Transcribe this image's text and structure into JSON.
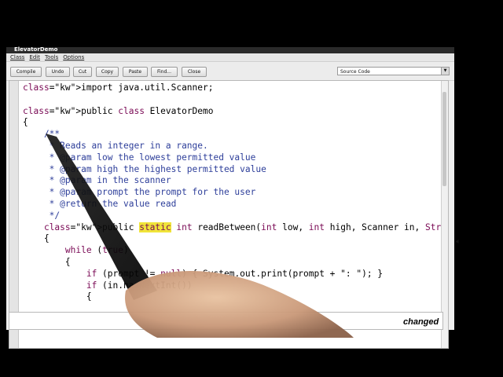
{
  "window": {
    "title": "ElevatorDemo"
  },
  "menu": [
    "Class",
    "Edit",
    "Tools",
    "Options"
  ],
  "toolbar": {
    "buttons": [
      "Compile",
      "Undo",
      "Cut",
      "Copy",
      "Paste",
      "Find...",
      "Close"
    ],
    "view_select": "Source Code"
  },
  "editor": {
    "lines": [
      "import java.util.Scanner;",
      "",
      "public class ElevatorDemo",
      "{",
      "    /**",
      "     * Reads an integer in a range.",
      "     * @param low the lowest permitted value",
      "     * @param high the highest permitted value",
      "     * @param in the scanner",
      "     * @param prompt the prompt for the user",
      "     * @return the value read",
      "     */",
      "    public static int readBetween(int low, int high, Scanner in, String prom",
      "    {",
      "        while (true)",
      "        {",
      "            if (prompt != null) { System.out.print(prompt + \": \"); }",
      "            if (in.hasNextInt())",
      "            {"
    ]
  },
  "status": {
    "text": "changed"
  },
  "colors": {
    "keyword": "#7a0a55",
    "comment": "#2d3e9a",
    "highlight": "#f0e43a"
  }
}
